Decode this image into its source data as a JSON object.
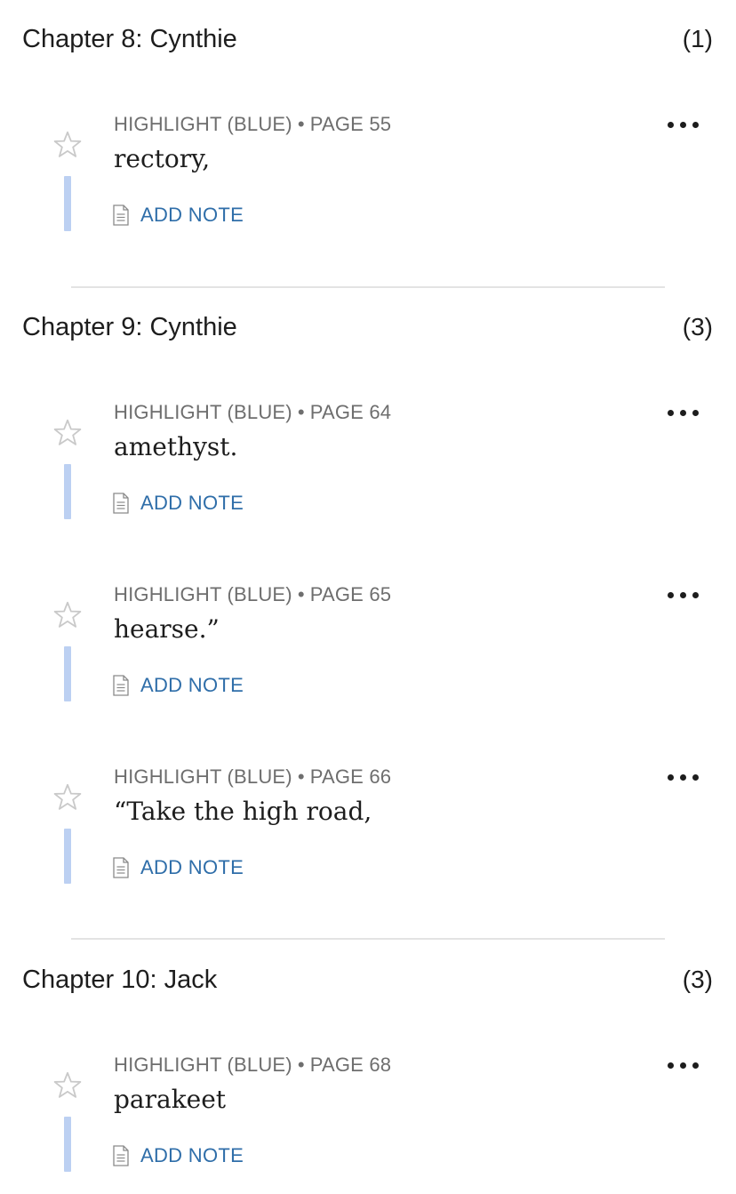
{
  "chapters": [
    {
      "title": "Chapter 8: Cynthie",
      "count": "(1)",
      "highlights": [
        {
          "type": "HIGHLIGHT (BLUE)",
          "page": "PAGE 55",
          "text": "rectory,",
          "action": "ADD NOTE"
        }
      ]
    },
    {
      "title": "Chapter 9: Cynthie",
      "count": "(3)",
      "highlights": [
        {
          "type": "HIGHLIGHT (BLUE)",
          "page": "PAGE 64",
          "text": "amethyst.",
          "action": "ADD NOTE"
        },
        {
          "type": "HIGHLIGHT (BLUE)",
          "page": "PAGE 65",
          "text": "hearse.”",
          "action": "ADD NOTE"
        },
        {
          "type": "HIGHLIGHT (BLUE)",
          "page": "PAGE 66",
          "text": "“Take the high road,",
          "action": "ADD NOTE"
        }
      ]
    },
    {
      "title": "Chapter 10: Jack",
      "count": "(3)",
      "highlights": [
        {
          "type": "HIGHLIGHT (BLUE)",
          "page": "PAGE 68",
          "text": "parakeet",
          "action": "ADD NOTE"
        }
      ]
    }
  ],
  "meta_separator": "•",
  "icons": {
    "favorite": "star-outline-icon",
    "more": "more-horizontal-icon",
    "note": "document-icon"
  },
  "colors": {
    "highlight_blue": "#bcd0f2",
    "link": "#2f6ea9",
    "meta_text": "#6e6e6e",
    "divider": "#e3e3e3"
  }
}
